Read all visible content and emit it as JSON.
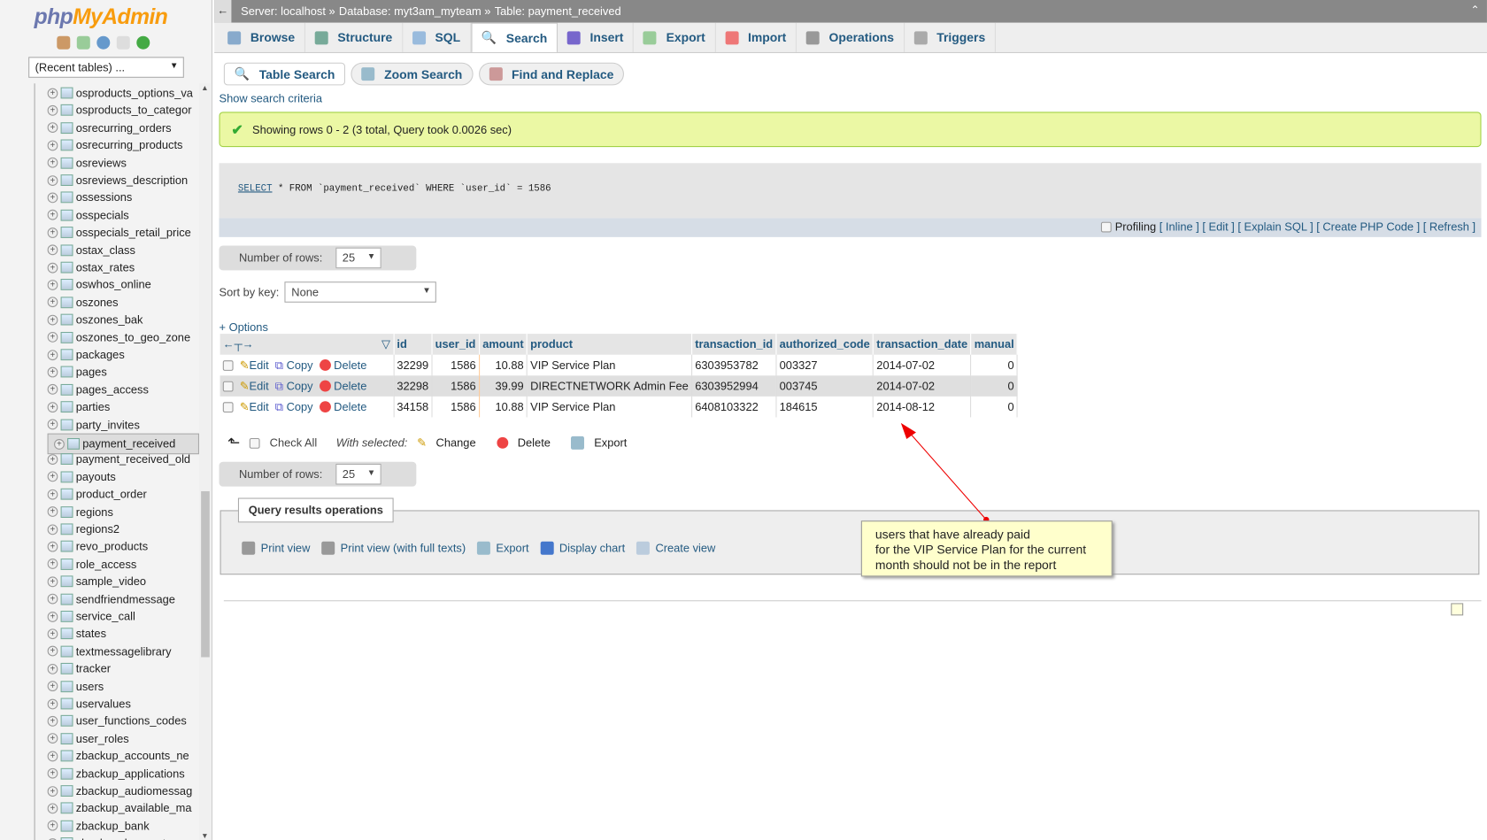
{
  "sidebar": {
    "logo_php": "php",
    "logo_myadmin": "MyAdmin",
    "recent_tables": "(Recent tables) ...",
    "tables": [
      "osproducts_options_va",
      "osproducts_to_categor",
      "osrecurring_orders",
      "osrecurring_products",
      "osreviews",
      "osreviews_description",
      "ossessions",
      "osspecials",
      "osspecials_retail_price",
      "ostax_class",
      "ostax_rates",
      "oswhos_online",
      "oszones",
      "oszones_bak",
      "oszones_to_geo_zone",
      "packages",
      "pages",
      "pages_access",
      "parties",
      "party_invites",
      "payment_received",
      "payment_received_old",
      "payouts",
      "product_order",
      "regions",
      "regions2",
      "revo_products",
      "role_access",
      "sample_video",
      "sendfriendmessage",
      "service_call",
      "states",
      "textmessagelibrary",
      "tracker",
      "users",
      "uservalues",
      "user_functions_codes",
      "user_roles",
      "zbackup_accounts_ne",
      "zbackup_applications",
      "zbackup_audiomessag",
      "zbackup_available_ma",
      "zbackup_bank",
      "zbackup_banquet_req"
    ],
    "selected": "payment_received"
  },
  "breadcrumb": {
    "server": "Server: localhost »",
    "database": "Database: myt3am_myteam »",
    "table": "Table: payment_received"
  },
  "tabs": [
    "Browse",
    "Structure",
    "SQL",
    "Search",
    "Insert",
    "Export",
    "Import",
    "Operations",
    "Triggers"
  ],
  "active_tab": "Search",
  "subtabs": [
    "Table Search",
    "Zoom Search",
    "Find and Replace"
  ],
  "show_search_criteria": "Show search criteria",
  "success": "Showing rows 0 - 2 (3 total, Query took 0.0026 sec)",
  "sql": {
    "keyword": "SELECT",
    "rest": " * FROM `payment_received` WHERE `user_id` = 1586"
  },
  "sql_links": {
    "profiling": "Profiling",
    "inline": "[ Inline ]",
    "edit": "[ Edit ]",
    "explain": "[ Explain SQL ]",
    "php": "[ Create PHP Code ]",
    "refresh": "[ Refresh ]"
  },
  "rows_label": "Number of rows:",
  "rows_value": "25",
  "sort_label": "Sort by key:",
  "sort_value": "None",
  "options": "+ Options",
  "columns": [
    "id",
    "user_id",
    "amount",
    "product",
    "transaction_id",
    "authorized_code",
    "transaction_date",
    "manual"
  ],
  "actions": {
    "edit": "Edit",
    "copy": "Copy",
    "delete": "Delete"
  },
  "rows": [
    [
      "32299",
      "1586",
      "10.88",
      "VIP Service Plan",
      "6303953782",
      "003327",
      "2014-07-02",
      "0"
    ],
    [
      "32298",
      "1586",
      "39.99",
      "DIRECTNETWORK Admin Fee",
      "6303952994",
      "003745",
      "2014-07-02",
      "0"
    ],
    [
      "34158",
      "1586",
      "10.88",
      "VIP Service Plan",
      "6408103322",
      "184615",
      "2014-08-12",
      "0"
    ]
  ],
  "with_selected": {
    "check_all": "Check All",
    "label": "With selected:",
    "change": "Change",
    "delete": "Delete",
    "export": "Export"
  },
  "qro": {
    "title": "Query results operations",
    "print": "Print view",
    "print_full": "Print view (with full texts)",
    "export": "Export",
    "chart": "Display chart",
    "view": "Create view"
  },
  "note": [
    "users that have already paid",
    "for the VIP Service Plan for the current",
    "month should not be in the report"
  ]
}
